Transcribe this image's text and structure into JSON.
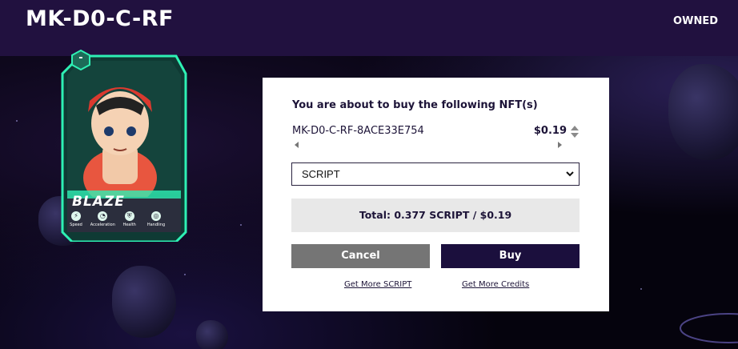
{
  "header": {
    "title": "MK-D0-C-RF",
    "owned_label": "OWNED"
  },
  "card": {
    "rank": "-",
    "name": "BLAZE",
    "stats": [
      {
        "label": "Speed",
        "icon": "lightning-icon"
      },
      {
        "label": "Acceleration",
        "icon": "gauge-icon"
      },
      {
        "label": "Health",
        "icon": "shield-icon"
      },
      {
        "label": "Handling",
        "icon": "steering-wheel-icon"
      }
    ],
    "accent_color": "#2ef0b4"
  },
  "modal": {
    "heading": "You are about to buy the following NFT(s)",
    "nft_id": "MK-D0-C-RF-8ACE33E754",
    "price": "$0.19",
    "currency_select": {
      "selected": "SCRIPT"
    },
    "total": "Total: 0.377 SCRIPT / $0.19",
    "cancel_label": "Cancel",
    "buy_label": "Buy",
    "link_script": "Get More SCRIPT",
    "link_credits": "Get More Credits"
  },
  "colors": {
    "header_bg": "#21113f",
    "buy_button": "#1b0f3d",
    "cancel_button": "#757575",
    "total_bg": "#e8e8e8"
  }
}
